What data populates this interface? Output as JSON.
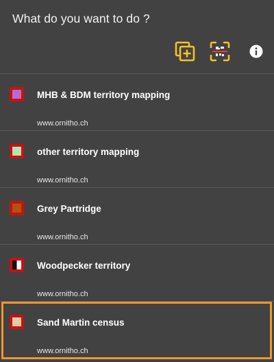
{
  "header": {
    "title": "What do you want to do ?"
  },
  "toolbar": {
    "add_icon": "add-copy-icon",
    "scan_icon": "qr-scan-icon",
    "info_icon": "info-icon",
    "accent_color": "#f5c02b"
  },
  "projects": [
    {
      "name": "MHB & BDM territory mapping",
      "url": "www.ornitho.ch",
      "swatch_border": "#c41313",
      "swatch_fill": "#b96ad0"
    },
    {
      "name": "other territory mapping",
      "url": "www.ornitho.ch",
      "swatch_border": "#c41313",
      "swatch_fill": "#b5e4b1"
    },
    {
      "name": "Grey Partridge",
      "url": "www.ornitho.ch",
      "swatch_border": "#c41313",
      "swatch_fill": "#b3520d"
    },
    {
      "name": "Woodpecker territory",
      "url": "www.ornitho.ch",
      "swatch_border": "#c41313",
      "swatch_fill": "split-black-white"
    },
    {
      "name": "Sand Martin census",
      "url": "www.ornitho.ch",
      "swatch_border": "#c41313",
      "swatch_fill": "#e9c8a6"
    }
  ],
  "selection_highlight_color": "#f0962c"
}
